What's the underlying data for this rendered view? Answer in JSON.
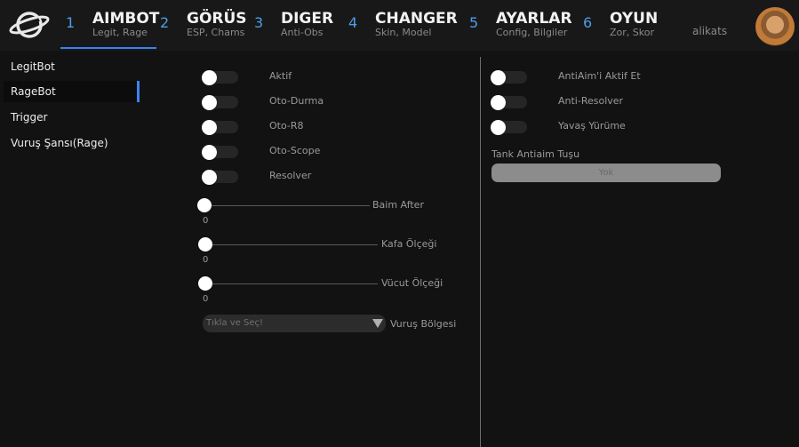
{
  "header": {
    "tabs": [
      {
        "num": "1",
        "title": "AIMBOT",
        "sub": "Legit, Rage",
        "active": true
      },
      {
        "num": "2",
        "title": "GÖRÜS",
        "sub": "ESP, Chams"
      },
      {
        "num": "3",
        "title": "DIGER",
        "sub": "Anti-Obs"
      },
      {
        "num": "4",
        "title": "CHANGER",
        "sub": "Skin, Model"
      },
      {
        "num": "5",
        "title": "AYARLAR",
        "sub": "Config, Bilgiler"
      },
      {
        "num": "6",
        "title": "OYUN",
        "sub": "Zor, Skor"
      }
    ],
    "username": "alikats",
    "accent": "#3b82f6",
    "number_color": "#4b9ee8"
  },
  "sidebar": {
    "items": [
      "LegitBot",
      "RageBot",
      "Trigger",
      "Vuruş Şansı(Rage)"
    ],
    "active": "RageBot"
  },
  "left": {
    "toggles": [
      {
        "label": "Aktif",
        "on": false
      },
      {
        "label": "Oto-Durma",
        "on": false
      },
      {
        "label": "Oto-R8",
        "on": false
      },
      {
        "label": "Oto-Scope",
        "on": false
      },
      {
        "label": "Resolver",
        "on": false
      }
    ],
    "sliders": [
      {
        "label": "Baim After",
        "value": "0"
      },
      {
        "label": "Kafa Ölçeği",
        "value": "0"
      },
      {
        "label": "Vücut Ölçeği",
        "value": "0"
      }
    ],
    "dropdown": {
      "value": "Tıkla ve Seç!",
      "label": "Vuruş Bölgesi"
    }
  },
  "right": {
    "toggles": [
      {
        "label": "AntiAim'i Aktif Et",
        "on": false
      },
      {
        "label": "Anti-Resolver",
        "on": false
      },
      {
        "label": "Yavaş Yürüme",
        "on": false
      }
    ],
    "key_label": "Tank Antiaim Tuşu",
    "key_value": "Yok"
  }
}
